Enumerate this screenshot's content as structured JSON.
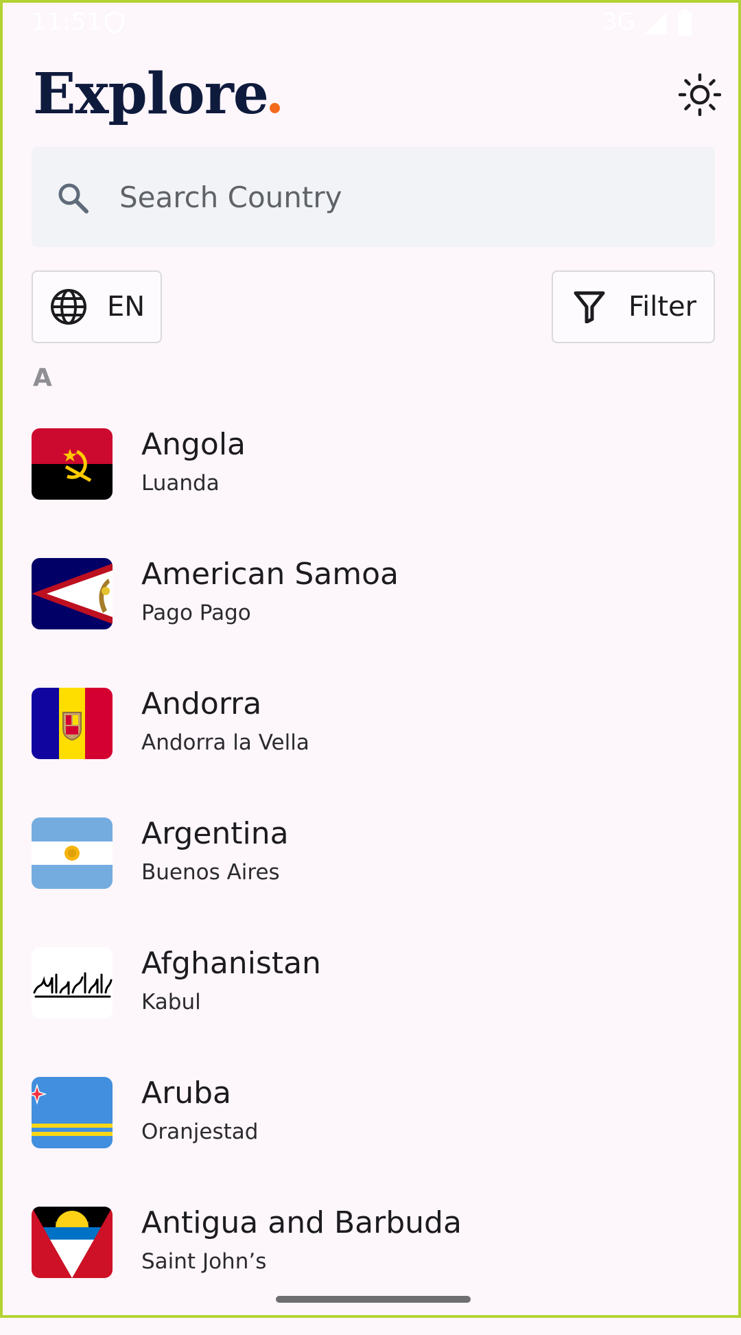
{
  "status_bar": {
    "time": "11:51",
    "network": "3G"
  },
  "header": {
    "logo_text": "Explore",
    "theme_toggle_icon": "sun-icon"
  },
  "search": {
    "placeholder": "Search Country",
    "value": ""
  },
  "controls": {
    "language_label": "EN",
    "filter_label": "Filter"
  },
  "sections": [
    {
      "letter": "A",
      "countries": [
        {
          "name": "Angola",
          "capital": "Luanda"
        },
        {
          "name": "American Samoa",
          "capital": "Pago Pago"
        },
        {
          "name": "Andorra",
          "capital": "Andorra la Vella"
        },
        {
          "name": "Argentina",
          "capital": "Buenos Aires"
        },
        {
          "name": "Afghanistan",
          "capital": "Kabul"
        },
        {
          "name": "Aruba",
          "capital": "Oranjestad"
        },
        {
          "name": "Antigua and Barbuda",
          "capital": "Saint John’s"
        }
      ]
    }
  ],
  "colors": {
    "background": "#fdf6fb",
    "logo": "#0f1b3d",
    "logo_accent": "#f26a1b",
    "search_bg": "#f1f3f6",
    "frame": "#b3d334"
  }
}
